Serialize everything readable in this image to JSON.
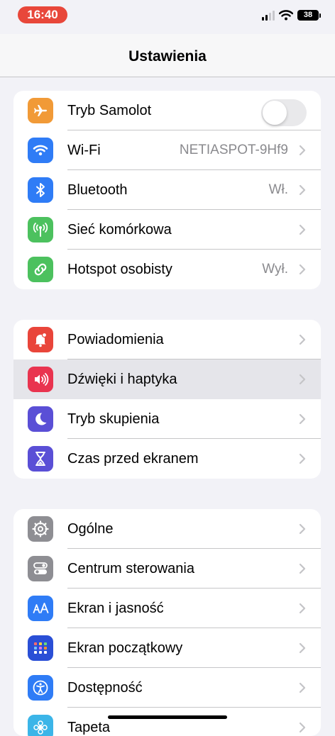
{
  "status": {
    "time": "16:40",
    "battery": "38"
  },
  "nav": {
    "title": "Ustawienia"
  },
  "groups": {
    "connectivity": [
      {
        "label": "Tryb Samolot",
        "toggle": "off"
      },
      {
        "label": "Wi-Fi",
        "value": "NETIASPOT-9Hf9"
      },
      {
        "label": "Bluetooth",
        "value": "Wł."
      },
      {
        "label": "Sieć komórkowa"
      },
      {
        "label": "Hotspot osobisty",
        "value": "Wył."
      }
    ],
    "notifications": [
      {
        "label": "Powiadomienia"
      },
      {
        "label": "Dźwięki i haptyka",
        "selected": true
      },
      {
        "label": "Tryb skupienia"
      },
      {
        "label": "Czas przed ekranem"
      }
    ],
    "general": [
      {
        "label": "Ogólne"
      },
      {
        "label": "Centrum sterowania"
      },
      {
        "label": "Ekran i jasność"
      },
      {
        "label": "Ekran początkowy"
      },
      {
        "label": "Dostępność"
      },
      {
        "label": "Tapeta"
      }
    ]
  },
  "icons": {
    "airplane": {
      "name": "airplane-icon",
      "color": "#f19a37"
    },
    "wifi": {
      "name": "wifi-icon",
      "color": "#2f7cf6"
    },
    "bluetooth": {
      "name": "bluetooth-icon",
      "color": "#2f7cf6"
    },
    "cellular": {
      "name": "cellular-icon",
      "color": "#4cc15e"
    },
    "hotspot": {
      "name": "hotspot-icon",
      "color": "#4cc15e"
    },
    "notifications": {
      "name": "bell-icon",
      "color": "#e9453a"
    },
    "sounds": {
      "name": "speaker-icon",
      "color": "#e9344f"
    },
    "focus": {
      "name": "moon-icon",
      "color": "#5a4fd6"
    },
    "screentime": {
      "name": "hourglass-icon",
      "color": "#5a4fd6"
    },
    "general": {
      "name": "gear-icon",
      "color": "#8e8e93"
    },
    "control": {
      "name": "switches-icon",
      "color": "#8e8e93"
    },
    "display": {
      "name": "text-size-icon",
      "color": "#2f7cf6"
    },
    "homescreen": {
      "name": "app-grid-icon",
      "color": "#2a4fd6"
    },
    "accessibility": {
      "name": "accessibility-icon",
      "color": "#2f7cf6"
    },
    "wallpaper": {
      "name": "flower-icon",
      "color": "#3bb5e8"
    }
  }
}
